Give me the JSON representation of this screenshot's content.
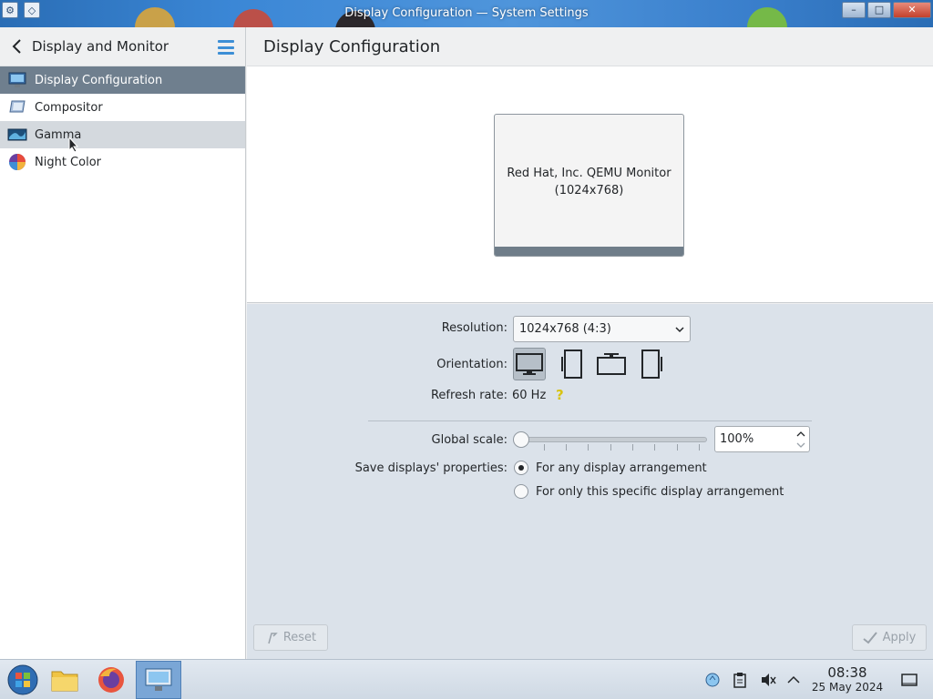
{
  "window": {
    "title": "Display Configuration — System Settings",
    "minimize_glyph": "–",
    "maximize_glyph": "□",
    "close_glyph": "✕"
  },
  "sidebar": {
    "title": "Display and Monitor",
    "items": [
      {
        "label": "Display Configuration",
        "icon": "display-icon",
        "state": "selected"
      },
      {
        "label": "Compositor",
        "icon": "compositor-icon",
        "state": "normal"
      },
      {
        "label": "Gamma",
        "icon": "gamma-icon",
        "state": "hover"
      },
      {
        "label": "Night Color",
        "icon": "night-color-icon",
        "state": "normal"
      }
    ]
  },
  "main": {
    "title": "Display Configuration",
    "monitor": {
      "name": "Red Hat, Inc. QEMU Monitor",
      "resolution": "(1024x768)"
    },
    "resolution": {
      "label": "Resolution:",
      "value": "1024x768 (4:3)"
    },
    "orientation": {
      "label": "Orientation:",
      "options": [
        "landscape",
        "portrait-left",
        "landscape-flipped",
        "portrait-right"
      ],
      "selected": "landscape"
    },
    "refresh_rate": {
      "label": "Refresh rate:",
      "value": "60 Hz"
    },
    "global_scale": {
      "label": "Global scale:",
      "value": "100%",
      "slider_fraction": 0
    },
    "save_properties": {
      "label": "Save displays' properties:",
      "options": [
        {
          "label": "For any display arrangement",
          "checked": true
        },
        {
          "label": "For only this specific display arrangement",
          "checked": false
        }
      ]
    },
    "buttons": {
      "reset": "Reset",
      "apply": "Apply"
    }
  },
  "taskbar": {
    "apps": [
      "start-icon",
      "file-manager-icon",
      "firefox-icon",
      "system-settings-icon"
    ],
    "time": "08:38",
    "date": "25 May 2024"
  },
  "colors": {
    "accent": "#3d8fd6",
    "selected_item": "#6f7f8e",
    "settings_bg": "#dbe2ea"
  }
}
